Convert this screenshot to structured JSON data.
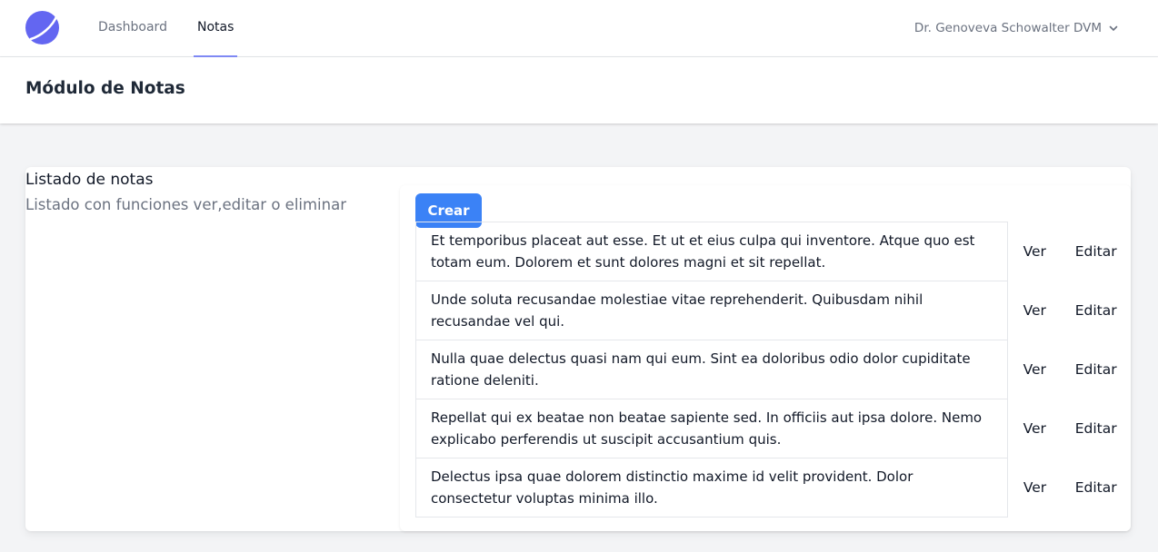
{
  "nav": {
    "logo": "app-logo",
    "links": [
      {
        "label": "Dashboard",
        "active": false
      },
      {
        "label": "Notas",
        "active": true
      }
    ],
    "user_name": "Dr. Genoveva Schowalter DVM",
    "user_menu_icon": "chevron-down-icon"
  },
  "header": {
    "title": "Módulo de Notas"
  },
  "section": {
    "title": "Listado de notas",
    "description": "Listado con funciones ver,editar o eliminar"
  },
  "actions": {
    "create_label": "Crear"
  },
  "notes": [
    {
      "text": "Et temporibus placeat aut esse. Et ut et eius culpa qui inventore. Atque quo est totam eum. Dolorem et sunt dolores magni et sit repellat.",
      "view_label": "Ver",
      "edit_label": "Editar"
    },
    {
      "text": "Unde soluta recusandae molestiae vitae reprehenderit. Quibusdam nihil recusandae vel qui.",
      "view_label": "Ver",
      "edit_label": "Editar"
    },
    {
      "text": "Nulla quae delectus quasi nam qui eum. Sint ea doloribus odio dolor cupiditate ratione deleniti.",
      "view_label": "Ver",
      "edit_label": "Editar"
    },
    {
      "text": "Repellat qui ex beatae non beatae sapiente sed. In officiis aut ipsa dolore. Nemo explicabo perferendis ut suscipit accusantium quis.",
      "view_label": "Ver",
      "edit_label": "Editar"
    },
    {
      "text": "Delectus ipsa quae dolorem distinctio maxime id velit provident. Dolor consectetur voluptas minima illo.",
      "view_label": "Ver",
      "edit_label": "Editar"
    }
  ],
  "colors": {
    "accent": "#818cf8",
    "button": "#3b82f6",
    "background": "#f3f4f6"
  }
}
